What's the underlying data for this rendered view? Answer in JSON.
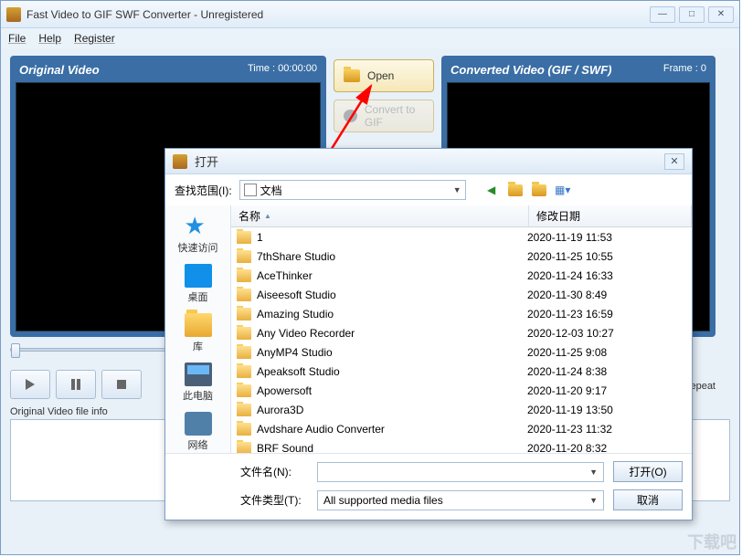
{
  "window": {
    "title": "Fast Video to GIF SWF Converter - Unregistered"
  },
  "menu": {
    "file": "File",
    "help": "Help",
    "register": "Register"
  },
  "panels": {
    "left_title": "Original Video",
    "left_meta": "Time : 00:00:00",
    "right_title": "Converted Video (GIF / SWF)",
    "right_meta": "Frame : 0"
  },
  "buttons": {
    "open": "Open",
    "convert": "Convert to GIF"
  },
  "repeat_label": "Repeat",
  "info_label": "Original Video file info",
  "dialog": {
    "title": "打开",
    "lookin_label": "查找范围(I):",
    "lookin_value": "文档",
    "places": {
      "quick": "快速访问",
      "desktop": "桌面",
      "libraries": "库",
      "thispc": "此电脑",
      "network": "网络"
    },
    "columns": {
      "name": "名称",
      "date": "修改日期"
    },
    "files": [
      {
        "name": "1",
        "date": "2020-11-19 11:53"
      },
      {
        "name": "7thShare Studio",
        "date": "2020-11-25 10:55"
      },
      {
        "name": "AceThinker",
        "date": "2020-11-24 16:33"
      },
      {
        "name": "Aiseesoft Studio",
        "date": "2020-11-30 8:49"
      },
      {
        "name": "Amazing Studio",
        "date": "2020-11-23 16:59"
      },
      {
        "name": "Any Video Recorder",
        "date": "2020-12-03 10:27"
      },
      {
        "name": "AnyMP4 Studio",
        "date": "2020-11-25 9:08"
      },
      {
        "name": "Apeaksoft Studio",
        "date": "2020-11-24 8:38"
      },
      {
        "name": "Apowersoft",
        "date": "2020-11-20 9:17"
      },
      {
        "name": "Aurora3D",
        "date": "2020-11-19 13:50"
      },
      {
        "name": "Avdshare Audio Converter",
        "date": "2020-11-23 11:32"
      },
      {
        "name": "BRF Sound",
        "date": "2020-11-20 8:32"
      }
    ],
    "filename_label": "文件名(N):",
    "filename_value": "",
    "filetype_label": "文件类型(T):",
    "filetype_value": "All supported media files",
    "open_btn": "打开(O)",
    "cancel_btn": "取消"
  },
  "watermark": "下载吧"
}
